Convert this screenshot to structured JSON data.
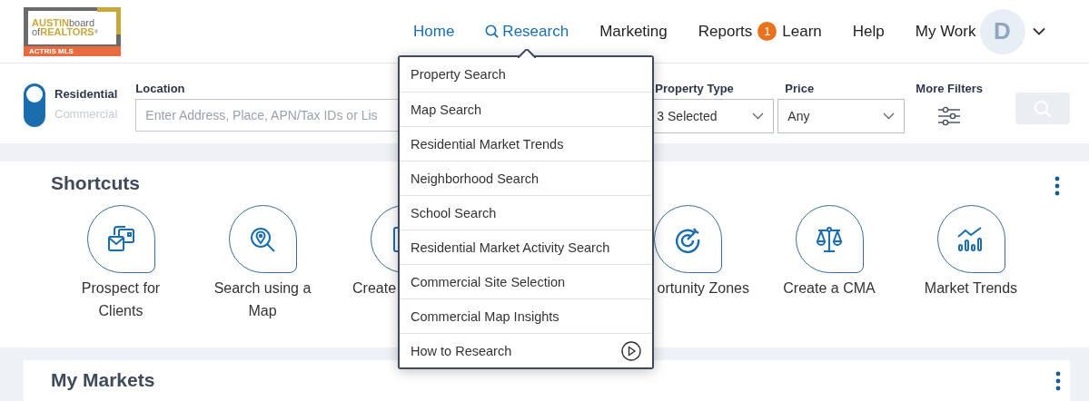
{
  "logo": {
    "line_1_bold": "AUSTIN",
    "line_1_light": "board",
    "line_2_light": "of",
    "line_2_bold": "REALTORS",
    "mark": "®",
    "band": "ACTRIS MLS"
  },
  "nav": [
    {
      "label": "Home",
      "selected": true
    },
    {
      "label": "Research",
      "selected": true
    },
    {
      "label": "Marketing",
      "selected": false
    },
    {
      "label": "Reports",
      "selected": false,
      "badge": "1"
    },
    {
      "label": "Learn",
      "selected": false
    },
    {
      "label": "Help",
      "selected": false
    },
    {
      "label": "My Work",
      "selected": false
    }
  ],
  "avatar": {
    "initial": "D"
  },
  "filters": {
    "mode": [
      {
        "label": "Residential",
        "selected": true
      },
      {
        "label": "Commercial",
        "selected": false
      }
    ],
    "location": {
      "label": "Location",
      "placeholder": "Enter Address, Place, APN/Tax IDs or Lis"
    },
    "property_type": {
      "label": "Property Type",
      "value": "3 Selected"
    },
    "price": {
      "label": "Price",
      "value": "Any"
    },
    "more_filters": {
      "label": "More Filters"
    }
  },
  "research_menu": [
    {
      "label": "Property Search"
    },
    {
      "label": "Map Search"
    },
    {
      "label": "Residential Market Trends"
    },
    {
      "label": "Neighborhood Search"
    },
    {
      "label": "School Search"
    },
    {
      "label": "Residential Market Activity Search"
    },
    {
      "label": "Commercial Site Selection"
    },
    {
      "label": "Commercial Map Insights"
    },
    {
      "label": "How to Research"
    }
  ],
  "shortcuts": {
    "title": "Shortcuts",
    "items": [
      {
        "label": "Prospect for Clients",
        "kind": "whole"
      },
      {
        "label": "Search using a Map",
        "kind": "whole"
      },
      {
        "label": "Create",
        "kind": "cut_right"
      },
      {
        "kind": "hidden"
      },
      {
        "label": "ortunity Zones",
        "kind": "cut_left"
      },
      {
        "label": "Create a CMA",
        "kind": "whole"
      },
      {
        "label": "Market Trends",
        "kind": "whole"
      }
    ]
  },
  "markets": {
    "title": "My Markets"
  }
}
